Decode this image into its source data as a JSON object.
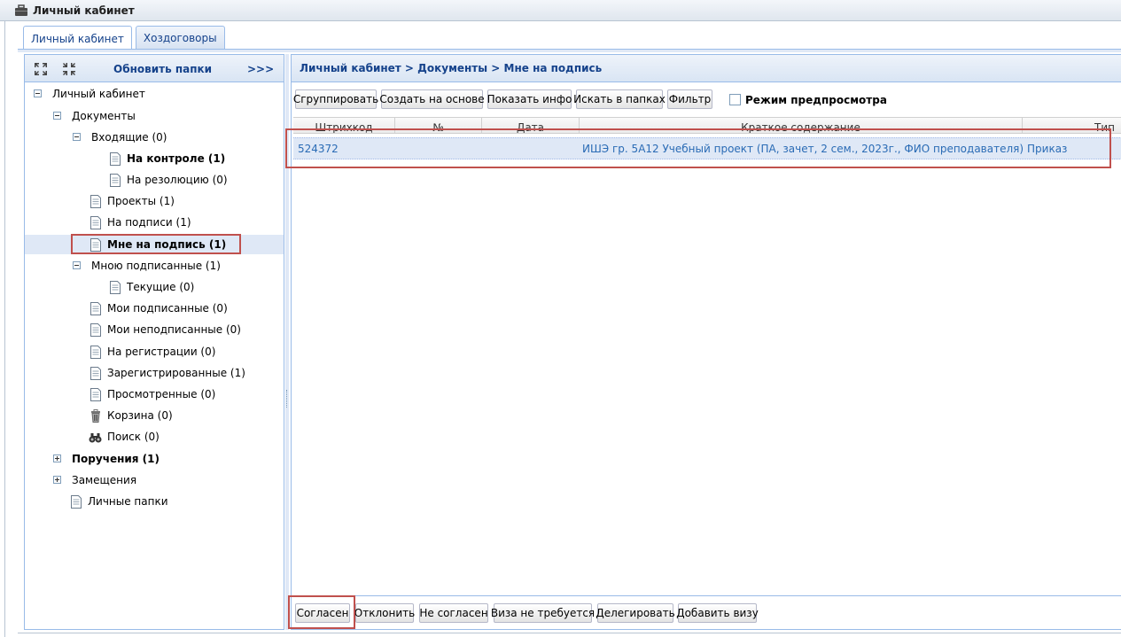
{
  "window": {
    "title": "Личный кабинет",
    "icon": "briefcase-icon"
  },
  "tabs": [
    {
      "label": "Личный кабинет",
      "active": true
    },
    {
      "label": "Хоздоговоры",
      "active": false
    }
  ],
  "left_toolbar": {
    "expand_icon": "expand-all-icon",
    "collapse_icon": "collapse-all-icon",
    "refresh_label": "Обновить папки",
    "more_label": ">>>"
  },
  "tree": [
    {
      "label": "Личный кабинет",
      "toggle": "minus"
    },
    {
      "label": "Документы",
      "toggle": "minus"
    },
    {
      "label": "Входящие (0)",
      "toggle": "minus"
    },
    {
      "label": "На контроле (1)",
      "icon": "document-icon",
      "bold": true
    },
    {
      "label": "На резолюцию (0)",
      "icon": "document-icon"
    },
    {
      "label": "Проекты (1)",
      "icon": "document-icon"
    },
    {
      "label": "На подписи (1)",
      "icon": "document-icon"
    },
    {
      "label": "Мне на подпись (1)",
      "icon": "document-icon",
      "bold": true,
      "selected": true
    },
    {
      "label": "Мною подписанные (1)",
      "toggle": "minus"
    },
    {
      "label": "Текущие (0)",
      "icon": "document-icon"
    },
    {
      "label": "Мои подписанные (0)",
      "icon": "document-icon"
    },
    {
      "label": "Мои неподписанные (0)",
      "icon": "document-icon"
    },
    {
      "label": "На регистрации (0)",
      "icon": "document-icon"
    },
    {
      "label": "Зарегистрированные (1)",
      "icon": "document-icon"
    },
    {
      "label": "Просмотренные (0)",
      "icon": "document-icon"
    },
    {
      "label": "Корзина (0)",
      "icon": "trash-icon"
    },
    {
      "label": "Поиск (0)",
      "icon": "binoculars-icon"
    },
    {
      "label": "Поручения (1)",
      "toggle": "plus",
      "bold": true
    },
    {
      "label": "Замещения",
      "toggle": "plus"
    },
    {
      "label": "Личные папки",
      "icon": "document-icon"
    }
  ],
  "breadcrumb": "Личный кабинет > Документы > Мне на подпись",
  "toolbar": {
    "group": "Сгруппировать",
    "create_based": "Создать на основе",
    "show_info": "Показать инфо",
    "search_folders": "Искать в папках",
    "filter": "Фильтр",
    "preview_mode": "Режим предпросмотра",
    "preview_checked": false
  },
  "grid": {
    "columns": [
      "Штрихкод",
      "№",
      "Дата",
      "Краткое содержание",
      "Тип"
    ],
    "rows": [
      {
        "barcode": "524372",
        "number": "",
        "date": "",
        "summary": "ИШЭ гр. 5А12 Учебный проект (ПА, зачет, 2 сем., 2023г., ФИО преподавателя)",
        "type": "Приказ"
      }
    ]
  },
  "actions": {
    "approve": "Согласен",
    "reject": "Отклонить",
    "disagree": "Не согласен",
    "no_visa": "Виза не требуется",
    "delegate": "Делегировать",
    "add_visa": "Добавить визу"
  },
  "colors": {
    "accent": "#15428b",
    "border": "#99bbe8",
    "selection": "#dfe8f6",
    "highlight": "#c0504d",
    "link": "#2a6bb5"
  }
}
